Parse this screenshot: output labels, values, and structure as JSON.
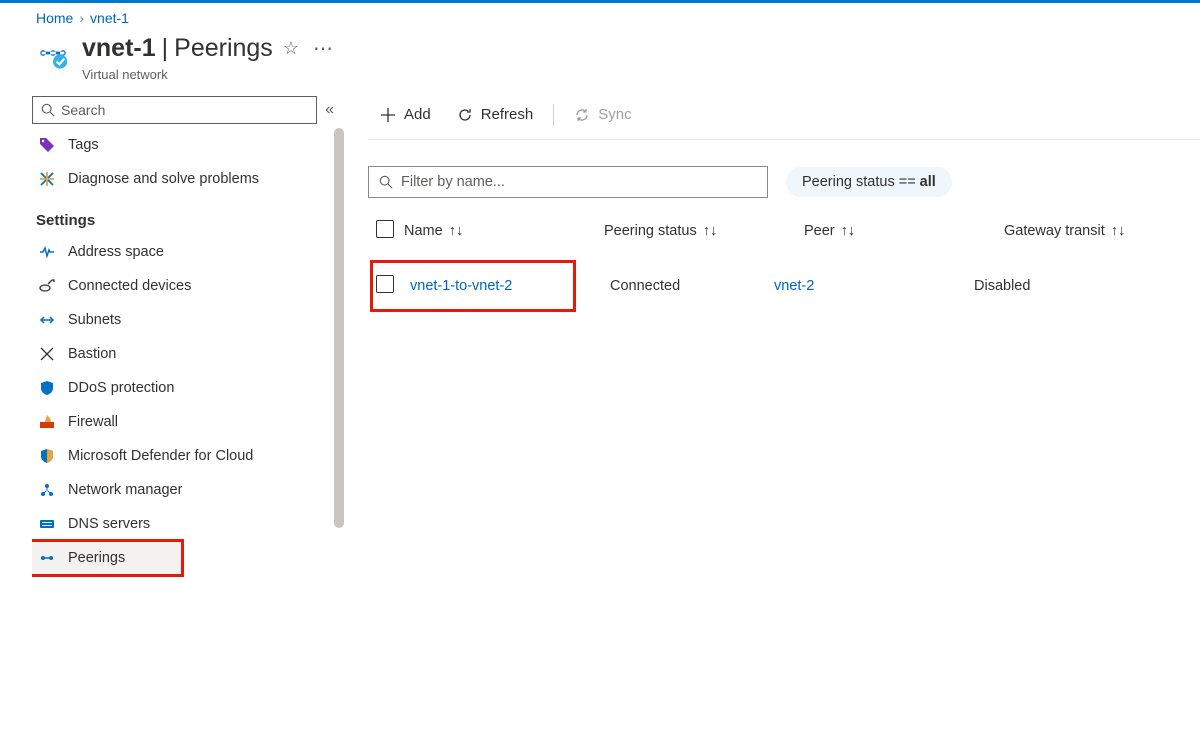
{
  "breadcrumbs": {
    "home": "Home",
    "resource": "vnet-1"
  },
  "header": {
    "title": "vnet-1",
    "section": "Peerings",
    "subtitle": "Virtual network"
  },
  "sidebar": {
    "search_placeholder": "Search",
    "items": {
      "tags": "Tags",
      "diagnose": "Diagnose and solve problems",
      "settings_header": "Settings",
      "address_space": "Address space",
      "connected_devices": "Connected devices",
      "subnets": "Subnets",
      "bastion": "Bastion",
      "ddos": "DDoS protection",
      "firewall": "Firewall",
      "defender": "Microsoft Defender for Cloud",
      "network_manager": "Network manager",
      "dns": "DNS servers",
      "peerings": "Peerings"
    }
  },
  "toolbar": {
    "add": "Add",
    "refresh": "Refresh",
    "sync": "Sync"
  },
  "filter": {
    "placeholder": "Filter by name...",
    "status_label": "Peering status ==",
    "status_value": "all"
  },
  "columns": {
    "name": "Name",
    "status": "Peering status",
    "peer": "Peer",
    "gateway": "Gateway transit"
  },
  "rows": [
    {
      "name": "vnet-1-to-vnet-2",
      "status": "Connected",
      "peer": "vnet-2",
      "gateway": "Disabled"
    }
  ]
}
